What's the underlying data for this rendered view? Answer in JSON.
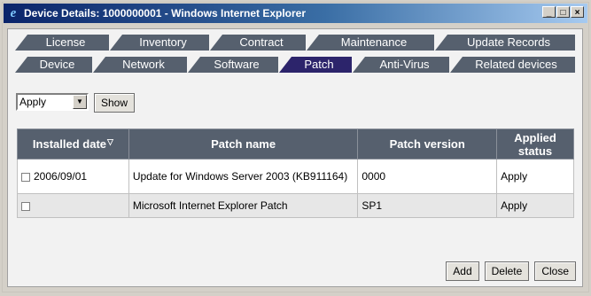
{
  "window": {
    "title": "Device Details: 1000000001 - Windows Internet Explorer",
    "icon": "ie-icon"
  },
  "tabs": {
    "row1": [
      "License",
      "Inventory",
      "Contract",
      "Maintenance",
      "Update Records"
    ],
    "row2": [
      "Device",
      "Network",
      "Software",
      "Patch",
      "Anti-Virus",
      "Related devices"
    ],
    "active": "Patch"
  },
  "filter": {
    "selected": "Apply",
    "show_label": "Show"
  },
  "table": {
    "columns": [
      "Installed date",
      "Patch name",
      "Patch version",
      "Applied status"
    ],
    "rows": [
      {
        "installed_date": "2006/09/01",
        "patch_name": "Update for Windows Server 2003 (KB911164)",
        "patch_version": "0000",
        "applied_status": "Apply"
      },
      {
        "installed_date": "",
        "patch_name": "Microsoft Internet Explorer Patch",
        "patch_version": "SP1",
        "applied_status": "Apply"
      }
    ]
  },
  "footer": {
    "add_label": "Add",
    "delete_label": "Delete",
    "close_label": "Close"
  }
}
